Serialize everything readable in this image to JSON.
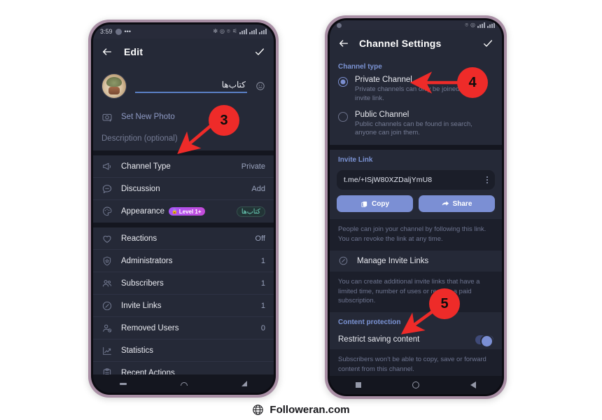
{
  "footer": {
    "brand": "Followeran.com",
    "icon": "globe-icon"
  },
  "colors": {
    "marker_red": "#ee2b29",
    "accent_blue": "#7b8fd4",
    "section_blue": "#7b93d4",
    "frame_purple": "#a98fa5",
    "screen_bg": "#1c1f2b",
    "panel_bg": "#252937",
    "teal_badge": "#6fd7c0",
    "level_badge": "#a855f7"
  },
  "left_phone": {
    "statusbar": {
      "time": "3:59",
      "dots": "•••",
      "icons": [
        "bluetooth-icon",
        "location-icon",
        "wifi-off-icon",
        "mute-icon",
        "signal-icon",
        "signal-2-icon",
        "battery-icon"
      ]
    },
    "appbar": {
      "back": "back-arrow-icon",
      "title": "Edit",
      "confirm": "check-icon"
    },
    "name_field": {
      "value": "کتاب‌ها",
      "emoji_icon": "smiley-icon",
      "avatar": "channel-avatar"
    },
    "set_photo": {
      "label": "Set New Photo",
      "icon": "camera-plus-icon"
    },
    "description": {
      "placeholder": "Description (optional)"
    },
    "rows": [
      {
        "label": "Channel Type",
        "value": "Private",
        "icon": "megaphone-icon",
        "value_style": "plain"
      },
      {
        "label": "Discussion",
        "value": "Add",
        "icon": "chat-bubble-icon",
        "value_style": "plain"
      },
      {
        "label": "Appearance",
        "value": "کتاب‌ها",
        "icon": "palette-icon",
        "value_style": "teal",
        "badge": "Level 1+",
        "badge_lock": "lock-icon"
      },
      {
        "label": "Reactions",
        "value": "Off",
        "icon": "heart-icon",
        "value_style": "plain"
      },
      {
        "label": "Administrators",
        "value": "1",
        "icon": "shield-star-icon",
        "value_style": "plain"
      },
      {
        "label": "Subscribers",
        "value": "1",
        "icon": "people-icon",
        "value_style": "plain"
      },
      {
        "label": "Invite Links",
        "value": "1",
        "icon": "link-icon",
        "value_style": "plain"
      },
      {
        "label": "Removed Users",
        "value": "0",
        "icon": "person-block-icon",
        "value_style": "plain"
      },
      {
        "label": "Statistics",
        "value": "",
        "icon": "chart-line-icon",
        "value_style": "plain"
      },
      {
        "label": "Recent Actions",
        "value": "",
        "icon": "clipboard-icon",
        "value_style": "plain"
      }
    ],
    "navbar": [
      "recents-dash-icon",
      "home-arc-icon",
      "back-triangle-icon"
    ]
  },
  "right_phone": {
    "statusbar": {
      "icons": [
        "status-icons"
      ]
    },
    "appbar": {
      "back": "back-arrow-icon",
      "title": "Channel Settings",
      "confirm": "check-icon"
    },
    "channel_type": {
      "section_title": "Channel type",
      "options": [
        {
          "label": "Private Channel",
          "sub": "Private channels can only be joined via an invite link.",
          "selected": true
        },
        {
          "label": "Public Channel",
          "sub": "Public channels can be found in search, anyone can join them.",
          "selected": false
        }
      ]
    },
    "invite_link": {
      "section_title": "Invite Link",
      "url": "t.me/+ISjW80XZDaljYmU8",
      "menu_icon": "kebab-menu-icon",
      "copy_label": "Copy",
      "copy_icon": "copy-icon",
      "share_label": "Share",
      "share_icon": "share-arrow-icon",
      "hint": "People can join your channel by following this link. You can revoke the link at any time."
    },
    "manage_links": {
      "label": "Manage Invite Links",
      "icon": "link-icon",
      "hint": "You can create additional invite links that have a limited time, number of uses or require a paid subscription."
    },
    "content_protection": {
      "section_title": "Content protection",
      "toggle_label": "Restrict saving content",
      "toggle_on": true,
      "hint": "Subscribers won't be able to copy, save or forward content from this channel."
    },
    "navbar": [
      "recents-square-icon",
      "home-circle-icon",
      "back-triangle-icon"
    ]
  },
  "annotations": [
    {
      "number": "3",
      "target": "channel-type-row"
    },
    {
      "number": "4",
      "target": "private-channel-option"
    },
    {
      "number": "5",
      "target": "restrict-saving-content-toggle"
    }
  ]
}
